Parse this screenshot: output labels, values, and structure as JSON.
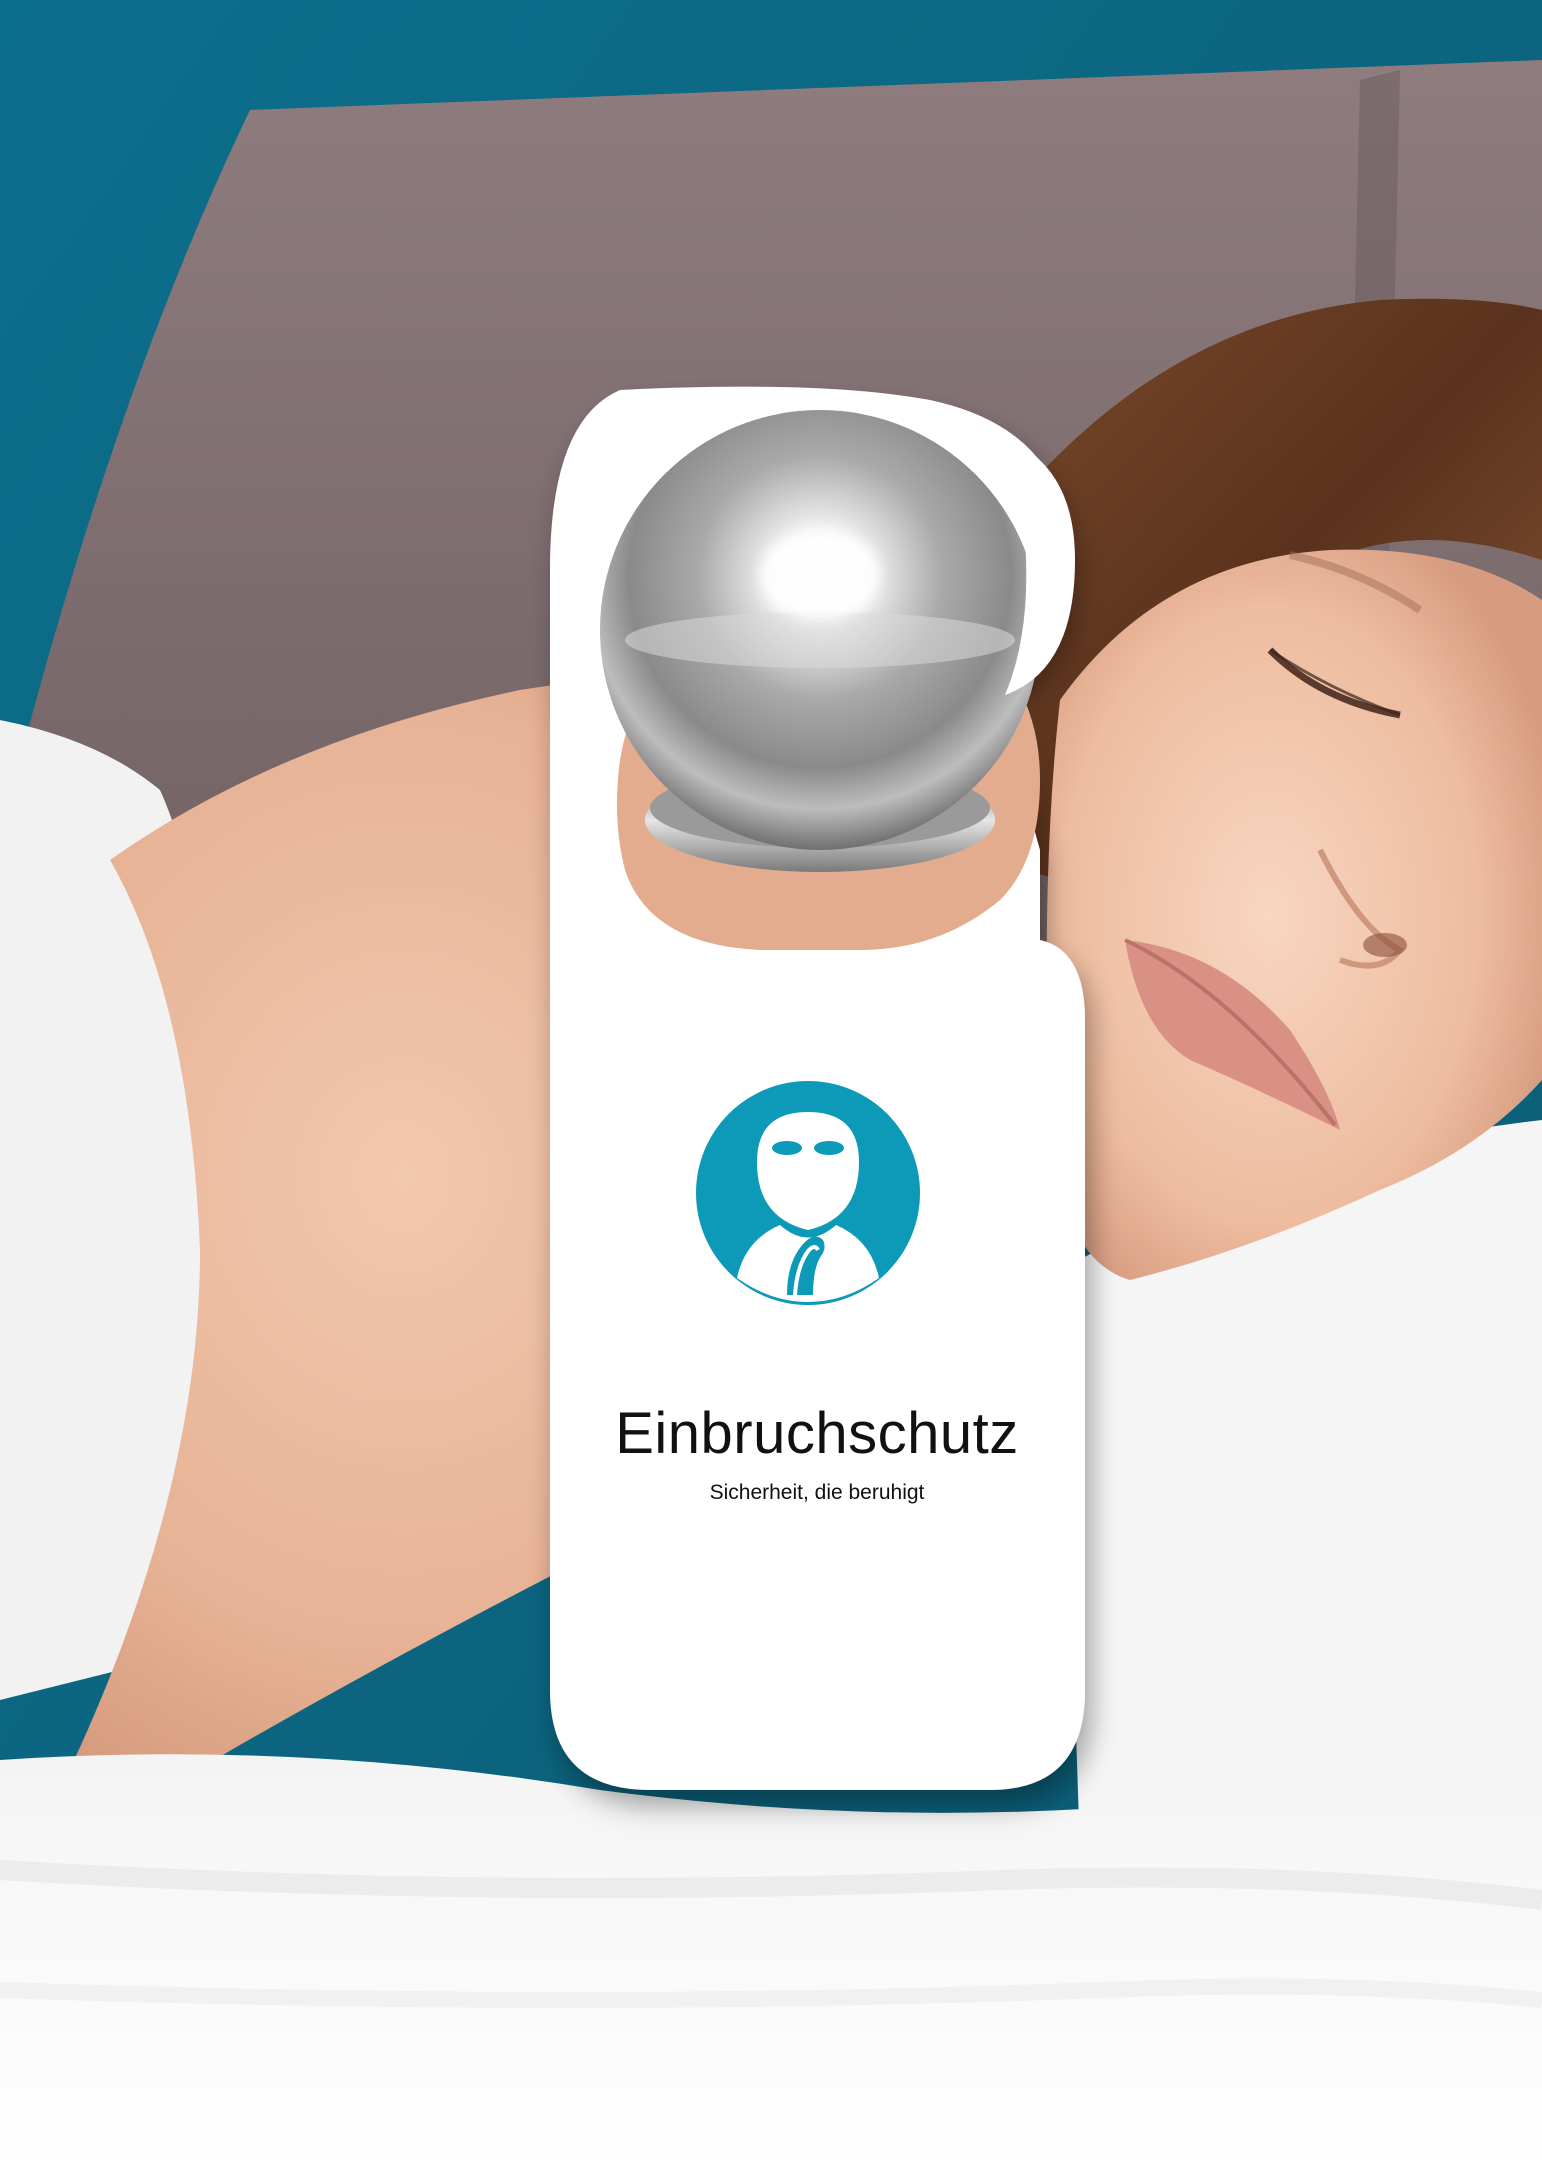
{
  "hanger": {
    "title": "Einbruchschutz",
    "subtitle": "Sicherheit, die beruhigt"
  },
  "icon": {
    "name": "burglar-icon",
    "color": "#0d9ab9"
  },
  "colors": {
    "wall": "#0f6a86",
    "headboard": "#8a7a7a",
    "skin": "#eab89c",
    "hair": "#6e3f24",
    "bedding": "#f6f6f6"
  }
}
